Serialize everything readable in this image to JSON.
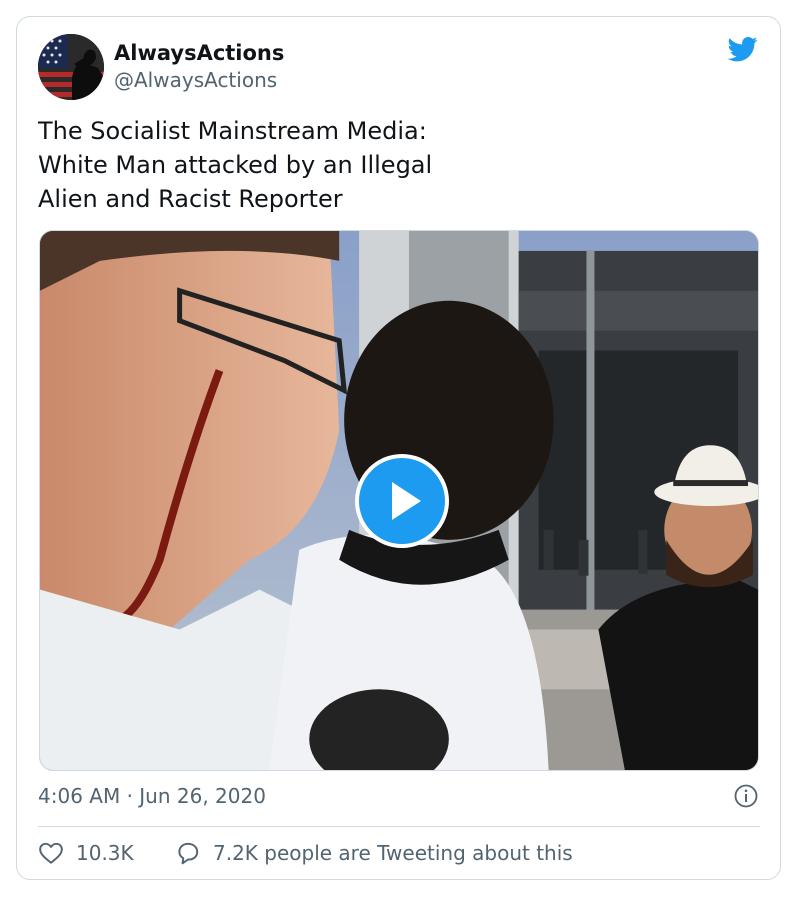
{
  "tweet": {
    "author_name": "AlwaysActions",
    "author_handle": "@AlwaysActions",
    "text_lines": [
      "The Socialist Mainstream Media:",
      "White Man attacked by an Illegal",
      "Alien and Racist Reporter"
    ],
    "timestamp": "4:06 AM · Jun 26, 2020",
    "like_count": "10.3K",
    "talk_text": "7.2K people are Tweeting about this",
    "media_type": "video"
  },
  "icons": {
    "brand": "twitter-bird-icon",
    "play": "play-icon",
    "info": "info-icon",
    "like": "heart-icon",
    "reply": "speech-bubble-icon"
  },
  "colors": {
    "brand_blue": "#1d9bf0",
    "text_primary": "#0f1419",
    "text_secondary": "#536471",
    "border": "#cfd9de"
  }
}
